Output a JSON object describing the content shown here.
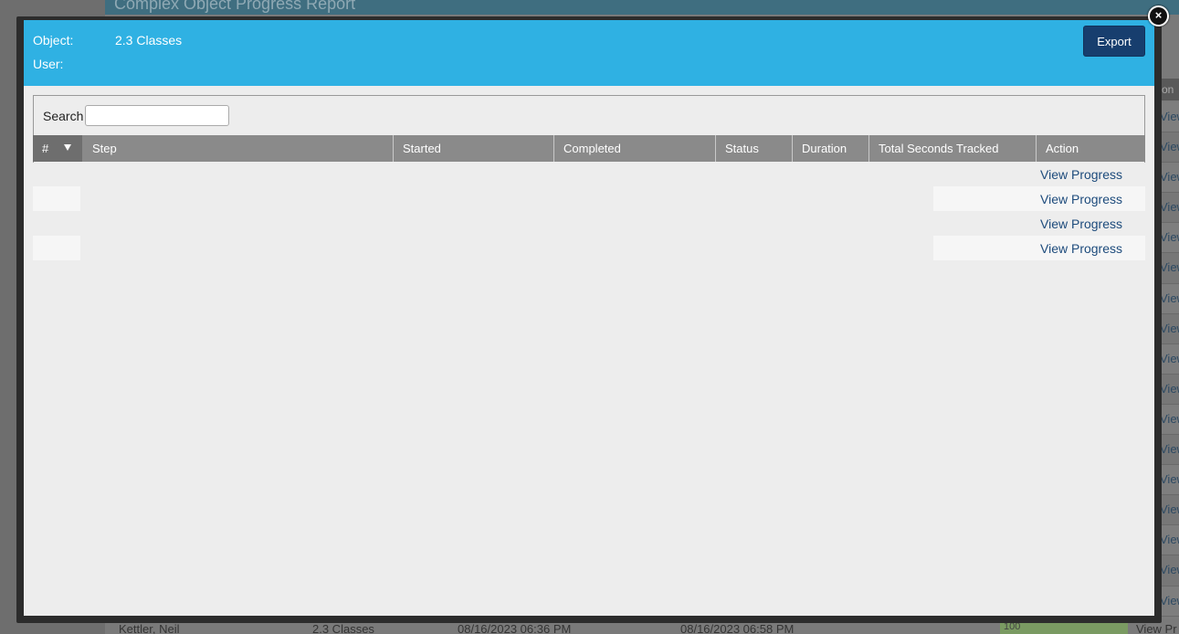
{
  "background": {
    "header_title": "Complex Object Progress Report",
    "column_fragment": "on",
    "row_link_fragment": "View Pr",
    "bottom_row": {
      "name": "Kettler, Neil",
      "object": "2.3 Classes",
      "started": "08/16/2023 06:36 PM",
      "completed": "08/16/2023 06:58 PM",
      "progress": "100",
      "action": "View Pr"
    }
  },
  "modal": {
    "close_icon": "close-icon",
    "object_label": "Object:",
    "object_value": "2.3 Classes",
    "user_label": "User:",
    "user_value": "",
    "export_label": "Export",
    "search_label": "Search",
    "search_value": "",
    "search_placeholder": "",
    "columns": {
      "num": "#",
      "step": "Step",
      "started": "Started",
      "completed": "Completed",
      "status": "Status",
      "duration": "Duration",
      "total_seconds": "Total Seconds Tracked",
      "action": "Action"
    },
    "sort_icon": "sort-descending-icon",
    "rows": [
      {
        "action": "View Progress"
      },
      {
        "action": "View Progress"
      },
      {
        "action": "View Progress"
      },
      {
        "action": "View Progress"
      }
    ]
  },
  "colors": {
    "header_blue": "#2fb1e3",
    "export_navy": "#173e6e",
    "table_header_gray": "#8a8a8a",
    "link_blue": "#1d4b7c"
  }
}
